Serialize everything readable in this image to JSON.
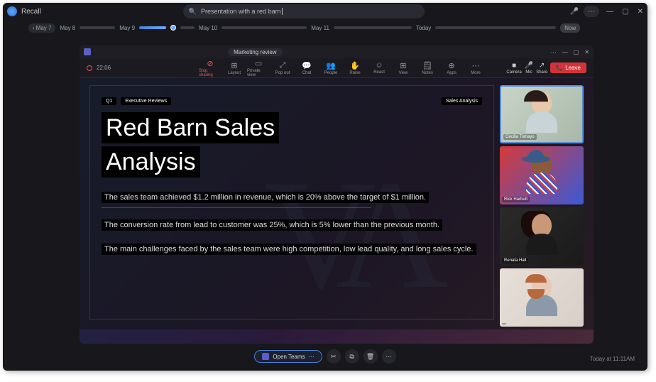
{
  "app": {
    "name": "Recall"
  },
  "search": {
    "value": "Presentation with a red barn"
  },
  "window_controls": {
    "min": "—",
    "max": "▢",
    "close": "✕"
  },
  "timeline": {
    "back_date": "May 7",
    "dates": [
      "May 8",
      "May 9",
      "May 10",
      "May 11",
      "Today"
    ],
    "now": "Now"
  },
  "teams": {
    "window_title": "Marketing review",
    "timer": "22:06",
    "toolbar": [
      {
        "icon": "⊘",
        "label": "Stop sharing",
        "red": true
      },
      {
        "icon": "⊞",
        "label": "Layout"
      },
      {
        "icon": "▭",
        "label": "Private view"
      },
      {
        "icon": "⤢",
        "label": "Pop out"
      },
      {
        "icon": "💬",
        "label": "Chat"
      },
      {
        "icon": "👥",
        "label": "People"
      },
      {
        "icon": "✋",
        "label": "Raise"
      },
      {
        "icon": "☺",
        "label": "React"
      },
      {
        "icon": "⊞",
        "label": "View"
      },
      {
        "icon": "🗒",
        "label": "Notes"
      },
      {
        "icon": "⊕",
        "label": "Apps"
      },
      {
        "icon": "⋯",
        "label": "More"
      }
    ],
    "right_tools": [
      {
        "icon": "■",
        "label": "Camera"
      },
      {
        "icon": "🎤",
        "label": "Mic"
      },
      {
        "icon": "↗",
        "label": "Share"
      }
    ],
    "leave": "Leave"
  },
  "slide": {
    "tag_q": "Q1",
    "tag_exec": "Executive Reviews",
    "tag_right": "Sales Analysis",
    "title_1": "Red Barn Sales",
    "title_2": "Analysis",
    "p1": "The sales team achieved $1.2 million in revenue, which is 20% above the target of $1 million.",
    "p2": "The conversion rate from lead to customer was 25%, which is 5% lower than the previous month.",
    "p3": "The main challenges faced by the sales team were high competition, low lead quality, and long sales cycle."
  },
  "participants": [
    {
      "name": "Cecilia Tomayo"
    },
    {
      "name": "Rick Harbutt"
    },
    {
      "name": "Renata Hall"
    },
    {
      "name": ""
    }
  ],
  "bottom": {
    "open_app": "Open Teams",
    "timestamp": "Today at 11:11AM"
  }
}
